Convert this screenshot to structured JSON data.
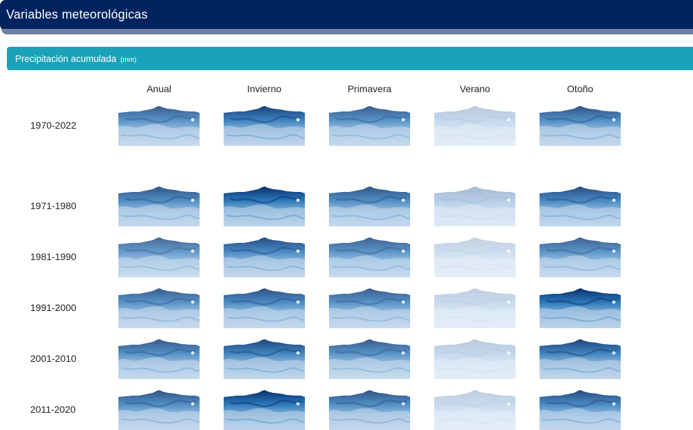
{
  "header": {
    "title": "Variables meteorológicas"
  },
  "section": {
    "title": "Precipitación acumulada",
    "unit": "(mm)"
  },
  "columns": [
    "Anual",
    "Invierno",
    "Primavera",
    "Verano",
    "Otoño"
  ],
  "rows": [
    {
      "label": "1970-2022",
      "intensity": [
        0.78,
        0.92,
        0.78,
        0.22,
        0.82
      ]
    },
    {
      "label": "1971-1980",
      "intensity": [
        0.82,
        1.0,
        0.82,
        0.3,
        0.86
      ]
    },
    {
      "label": "1981-1990",
      "intensity": [
        0.72,
        0.86,
        0.76,
        0.18,
        0.76
      ]
    },
    {
      "label": "1991-2000",
      "intensity": [
        0.78,
        0.84,
        0.78,
        0.2,
        1.0
      ]
    },
    {
      "label": "2001-2010",
      "intensity": [
        0.8,
        0.9,
        0.78,
        0.22,
        0.9
      ]
    },
    {
      "label": "2011-2020",
      "intensity": [
        0.82,
        1.0,
        0.82,
        0.2,
        0.86
      ]
    }
  ],
  "colors": {
    "header_bg": "#00235f",
    "header_underline": "#6f819f",
    "section_bg": "#1aa3b8",
    "map_dark": "#08306b",
    "map_mid": "#2171b5",
    "map_light": "#eef3fb"
  }
}
